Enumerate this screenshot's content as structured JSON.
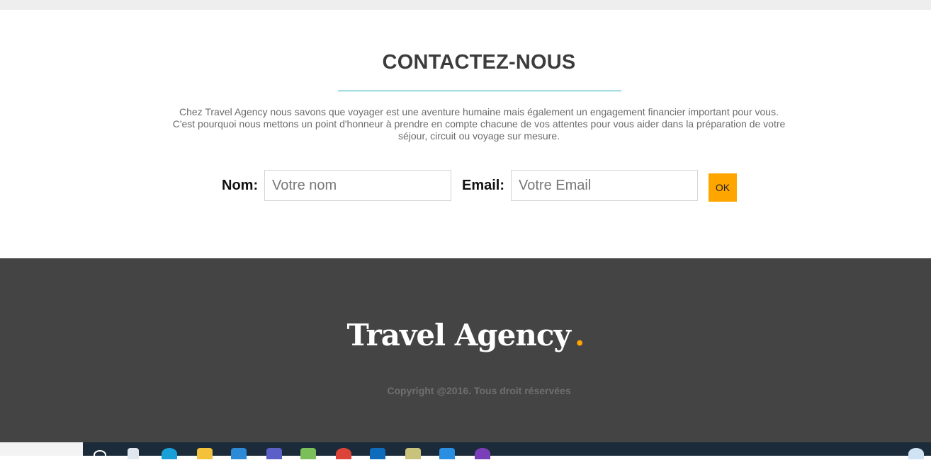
{
  "contact": {
    "title": "CONTACTEZ-NOUS",
    "intro_line1": "Chez Travel Agency nous savons que voyager est une aventure humaine mais également un engagement financier important pour vous.",
    "intro_line2": "C'est pourquoi nous mettons un point d'honneur à prendre en compte chacune de vos attentes pour vous aider dans la préparation de votre",
    "intro_line3": "séjour, circuit ou voyage sur mesure.",
    "form": {
      "name_label": "Nom:",
      "name_placeholder": "Votre nom",
      "email_label": "Email:",
      "email_placeholder": "Votre Email",
      "submit_label": "OK"
    }
  },
  "footer": {
    "brand": "Travel Agency",
    "brand_dot": ".",
    "copyright": "Copyright @2016. Tous droit réservées"
  },
  "colors": {
    "accent": "#ffa500",
    "underline": "#1aa6b7",
    "footer_bg": "#444444"
  },
  "taskbar": {
    "icons": [
      "search-icon",
      "task-view-icon",
      "edge-icon",
      "file-explorer-icon",
      "store-icon",
      "teams-icon",
      "excel-icon",
      "chrome-icon",
      "outlook-icon",
      "notepad-icon",
      "vscode-icon",
      "app-icon",
      "weather-icon"
    ]
  }
}
